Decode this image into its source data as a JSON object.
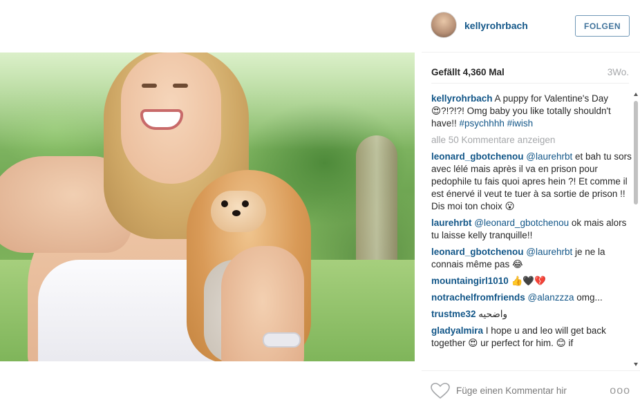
{
  "post": {
    "username": "kellyrohrbach",
    "follow_label": "FOLGEN",
    "likes": "Gefällt 4,360 Mal",
    "time": "3Wo.",
    "load_more": "alle 50 Kommentare anzeigen",
    "add_comment_placeholder": "Füge einen Kommentar hir",
    "more_label": "ooo"
  },
  "caption": {
    "user": "kellyrohrbach",
    "text_1": " A puppy for Valentine's Day 😍?!?!?! Omg baby you like totally shouldn't have!! ",
    "tag_1": "#psychhhh",
    "space": " ",
    "tag_2": "#iwish"
  },
  "comments": [
    {
      "user": "leonard_gbotchenou",
      "mention": "@laurehrbt",
      "text": " et bah tu sors avec lélé mais après il va en prison pour pedophile tu fais quoi apres hein ?! Et comme il est énervé il veut te tuer à sa sortie de prison !! Dis moi ton choix 😮"
    },
    {
      "user": "laurehrbt",
      "mention": "@leonard_gbotchenou",
      "text": " ok mais alors tu laisse kelly tranquille!!"
    },
    {
      "user": "leonard_gbotchenou",
      "mention": "@laurehrbt",
      "text": " je ne la connais même pas 😂"
    },
    {
      "user": "mountaingirl1010",
      "mention": "",
      "text": " 👍🖤💔"
    },
    {
      "user": "notrachelfromfriends",
      "mention": "@alanzzza",
      "text": " omg..."
    },
    {
      "user": "trustme32",
      "mention": "",
      "text": " واضحيه"
    },
    {
      "user": "gladyalmira",
      "mention": "",
      "text": " I hope u and leo will get back together 😍 ur perfect for him. 😊 if"
    }
  ]
}
